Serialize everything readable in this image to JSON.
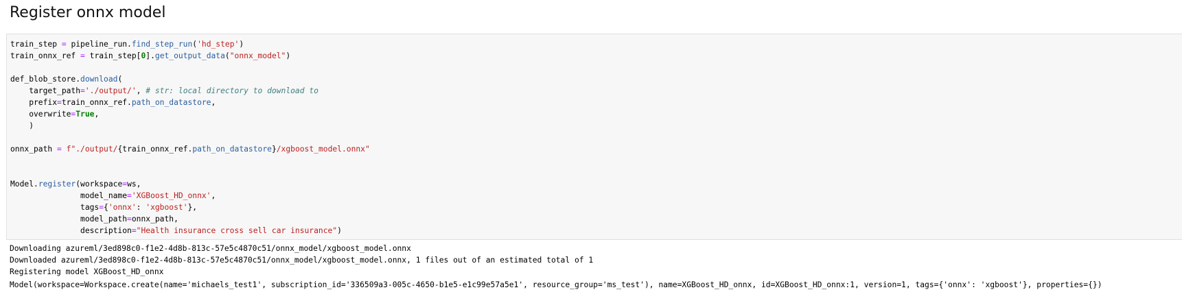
{
  "heading": "Register onnx model",
  "code_cell": {
    "lines": [
      [
        {
          "t": "train_step ",
          "c": ""
        },
        {
          "t": "=",
          "c": "op"
        },
        {
          "t": " pipeline_run.",
          "c": ""
        },
        {
          "t": "find_step_run",
          "c": "attr"
        },
        {
          "t": "(",
          "c": ""
        },
        {
          "t": "'hd_step'",
          "c": "str"
        },
        {
          "t": ")",
          "c": ""
        }
      ],
      [
        {
          "t": "train_onnx_ref ",
          "c": ""
        },
        {
          "t": "=",
          "c": "op"
        },
        {
          "t": " train_step[",
          "c": ""
        },
        {
          "t": "0",
          "c": "kw"
        },
        {
          "t": "].",
          "c": ""
        },
        {
          "t": "get_output_data",
          "c": "attr"
        },
        {
          "t": "(",
          "c": ""
        },
        {
          "t": "\"onnx_model\"",
          "c": "str"
        },
        {
          "t": ")",
          "c": ""
        }
      ],
      [],
      [
        {
          "t": "def_blob_store.",
          "c": ""
        },
        {
          "t": "download",
          "c": "attr"
        },
        {
          "t": "(",
          "c": ""
        }
      ],
      [
        {
          "t": "    target_path",
          "c": ""
        },
        {
          "t": "=",
          "c": "op"
        },
        {
          "t": "'./output/'",
          "c": "str"
        },
        {
          "t": ", ",
          "c": ""
        },
        {
          "t": "# str: local directory to download to",
          "c": "com"
        }
      ],
      [
        {
          "t": "    prefix",
          "c": ""
        },
        {
          "t": "=",
          "c": "op"
        },
        {
          "t": "train_onnx_ref.",
          "c": ""
        },
        {
          "t": "path_on_datastore",
          "c": "attr"
        },
        {
          "t": ",",
          "c": ""
        }
      ],
      [
        {
          "t": "    overwrite",
          "c": ""
        },
        {
          "t": "=",
          "c": "op"
        },
        {
          "t": "True",
          "c": "kw"
        },
        {
          "t": ",",
          "c": ""
        }
      ],
      [
        {
          "t": "    )",
          "c": ""
        }
      ],
      [],
      [
        {
          "t": "onnx_path ",
          "c": ""
        },
        {
          "t": "=",
          "c": "op"
        },
        {
          "t": " ",
          "c": ""
        },
        {
          "t": "f\"./output/",
          "c": "str"
        },
        {
          "t": "{",
          "c": ""
        },
        {
          "t": "train_onnx_ref.",
          "c": ""
        },
        {
          "t": "path_on_datastore",
          "c": "attr"
        },
        {
          "t": "}",
          "c": ""
        },
        {
          "t": "/xgboost_model.onnx\"",
          "c": "str"
        }
      ],
      [],
      [],
      [
        {
          "t": "Model.",
          "c": ""
        },
        {
          "t": "register",
          "c": "attr"
        },
        {
          "t": "(workspace",
          "c": ""
        },
        {
          "t": "=",
          "c": "op"
        },
        {
          "t": "ws,",
          "c": ""
        }
      ],
      [
        {
          "t": "               model_name",
          "c": ""
        },
        {
          "t": "=",
          "c": "op"
        },
        {
          "t": "'XGBoost_HD_onnx'",
          "c": "str"
        },
        {
          "t": ",",
          "c": ""
        }
      ],
      [
        {
          "t": "               tags",
          "c": ""
        },
        {
          "t": "=",
          "c": "op"
        },
        {
          "t": "{",
          "c": ""
        },
        {
          "t": "'onnx'",
          "c": "str"
        },
        {
          "t": ": ",
          "c": ""
        },
        {
          "t": "'xgboost'",
          "c": "str"
        },
        {
          "t": "},",
          "c": ""
        }
      ],
      [
        {
          "t": "               model_path",
          "c": ""
        },
        {
          "t": "=",
          "c": "op"
        },
        {
          "t": "onnx_path,",
          "c": ""
        }
      ],
      [
        {
          "t": "               description",
          "c": ""
        },
        {
          "t": "=",
          "c": "op"
        },
        {
          "t": "\"Health insurance cross sell car insurance\"",
          "c": "str"
        },
        {
          "t": ")",
          "c": ""
        }
      ]
    ]
  },
  "output": {
    "stream": [
      "Downloading azureml/3ed898c0-f1e2-4d8b-813c-57e5c4870c51/onnx_model/xgboost_model.onnx",
      "Downloaded azureml/3ed898c0-f1e2-4d8b-813c-57e5c4870c51/onnx_model/xgboost_model.onnx, 1 files out of an estimated total of 1",
      "Registering model XGBoost_HD_onnx"
    ],
    "result": "Model(workspace=Workspace.create(name='michaels_test1', subscription_id='336509a3-005c-4650-b1e5-e1c99e57a5e1', resource_group='ms_test'), name=XGBoost_HD_onnx, id=XGBoost_HD_onnx:1, version=1, tags={'onnx': 'xgboost'}, properties={})"
  }
}
